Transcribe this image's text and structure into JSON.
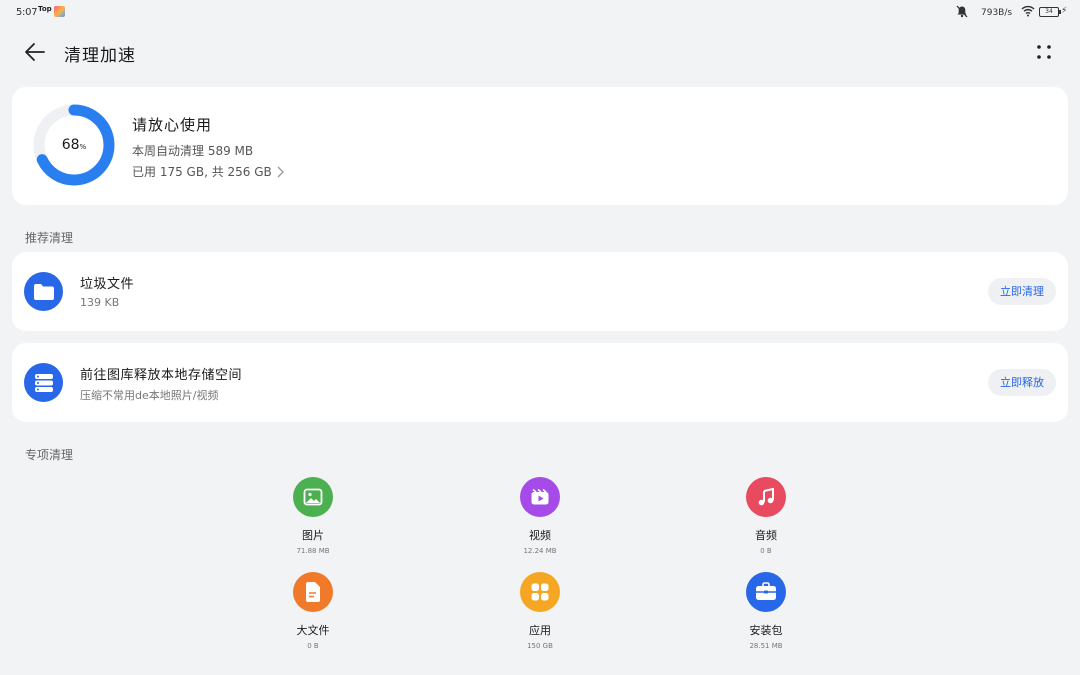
{
  "status_bar": {
    "time": "5:07",
    "app_tag": "Top",
    "net_speed": "793B/s",
    "battery": "34"
  },
  "header": {
    "title": "清理加速"
  },
  "storage": {
    "percent": "68",
    "percent_unit": "%",
    "percent_value": 0.68,
    "status": "请放心使用",
    "auto_clean": "本周自动清理 589 MB",
    "usage": "已用 175 GB, 共 256 GB",
    "ring_color": "#2a7ff0",
    "track_color": "#eef0f3"
  },
  "recommend": {
    "section_title": "推荐清理",
    "items": [
      {
        "title": "垃圾文件",
        "subtitle": "139 KB",
        "button": "立即清理",
        "icon": "folder-icon"
      },
      {
        "title": "前往图库释放本地存储空间",
        "subtitle": "压缩不常用de本地照片/视频",
        "button": "立即释放",
        "icon": "storage-icon"
      }
    ]
  },
  "special": {
    "section_title": "专项清理",
    "items": [
      {
        "label": "图片",
        "size": "71.88 MB",
        "color": "#4cb050",
        "icon": "image-icon"
      },
      {
        "label": "视频",
        "size": "12.24 MB",
        "color": "#a64be8",
        "icon": "video-icon"
      },
      {
        "label": "音频",
        "size": "0 B",
        "color": "#e84a5f",
        "icon": "music-icon"
      },
      {
        "label": "大文件",
        "size": "0 B",
        "color": "#f07a2a",
        "icon": "document-icon"
      },
      {
        "label": "应用",
        "size": "150 GB",
        "color": "#f5a623",
        "icon": "apps-icon"
      },
      {
        "label": "安装包",
        "size": "28.51 MB",
        "color": "#2767e8",
        "icon": "package-icon"
      }
    ]
  }
}
